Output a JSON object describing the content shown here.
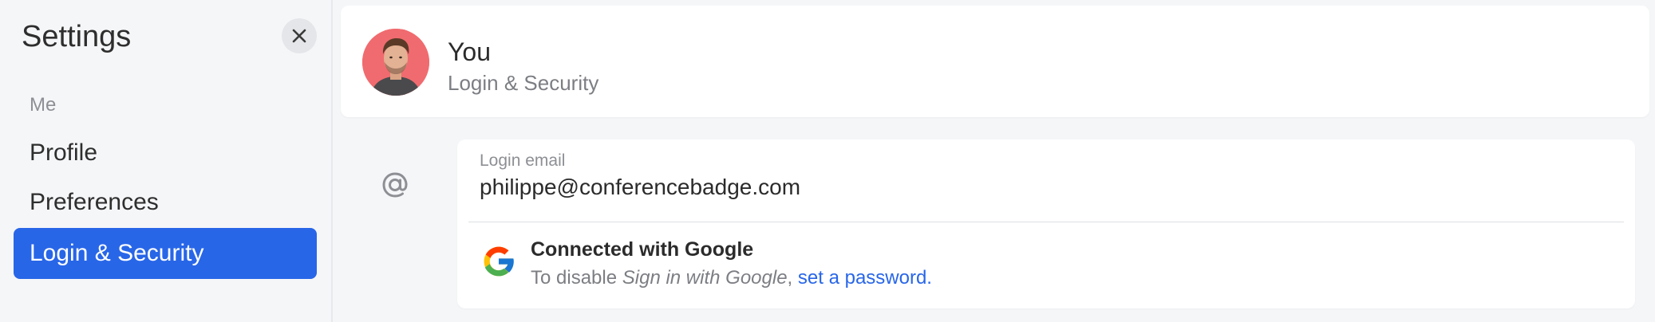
{
  "sidebar": {
    "title": "Settings",
    "close_icon": "close-icon",
    "section_label": "Me",
    "items": [
      {
        "label": "Profile",
        "active": false
      },
      {
        "label": "Preferences",
        "active": false
      },
      {
        "label": "Login & Security",
        "active": true
      }
    ]
  },
  "header": {
    "name": "You",
    "subtitle": "Login & Security",
    "avatar_icon": "user-avatar-photo"
  },
  "login": {
    "section_icon": "at-sign-icon",
    "email_label": "Login email",
    "email_value": "philippe@conferencebadge.com",
    "google": {
      "icon": "google-logo-icon",
      "title": "Connected with Google",
      "desc_prefix": "To disable ",
      "desc_italic": "Sign in with Google",
      "desc_separator": ", ",
      "link_text": "set a password."
    }
  },
  "colors": {
    "accent": "#2866e8",
    "background": "#f5f6f8",
    "avatar_bg": "#f06b6f"
  }
}
